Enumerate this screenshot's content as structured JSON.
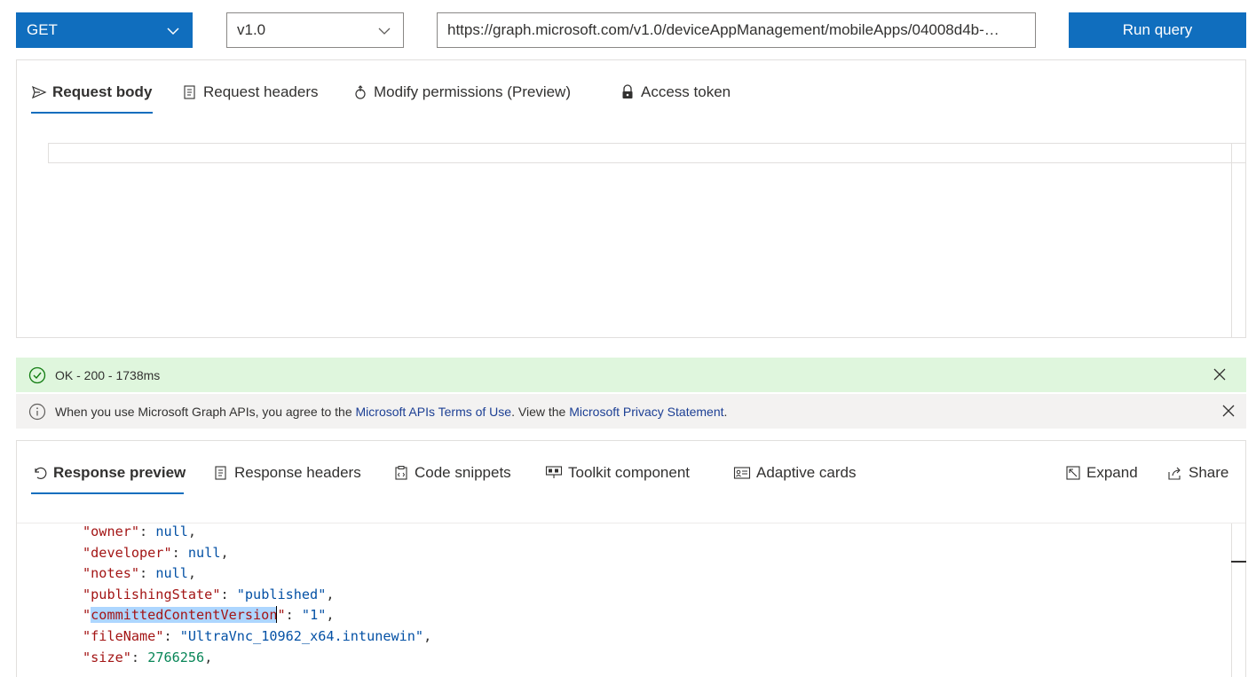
{
  "query": {
    "method": "GET",
    "version": "v1.0",
    "url": "https://graph.microsoft.com/v1.0/deviceAppManagement/mobileApps/04008d4b-…",
    "run_label": "Run query"
  },
  "request_tabs": [
    {
      "label": "Request body",
      "icon": "send-icon",
      "active": true
    },
    {
      "label": "Request headers",
      "icon": "headers-icon",
      "active": false
    },
    {
      "label": "Modify permissions (Preview)",
      "icon": "permissions-icon",
      "active": false
    },
    {
      "label": "Access token",
      "icon": "lock-icon",
      "active": false
    }
  ],
  "status": {
    "text": "OK - 200 - 1738ms",
    "icon": "check-circle-icon"
  },
  "info": {
    "prefix": "When you use Microsoft Graph APIs, you agree to the ",
    "terms_link": "Microsoft APIs Terms of Use",
    "middle": ". View the ",
    "privacy_link": "Microsoft Privacy Statement",
    "suffix": ".",
    "icon": "info-icon"
  },
  "response_tabs": [
    {
      "label": "Response preview",
      "icon": "undo-icon",
      "active": true
    },
    {
      "label": "Response headers",
      "icon": "headers-icon",
      "active": false
    },
    {
      "label": "Code snippets",
      "icon": "code-snippet-icon",
      "active": false
    },
    {
      "label": "Toolkit component",
      "icon": "toolkit-icon",
      "active": false
    },
    {
      "label": "Adaptive cards",
      "icon": "card-icon",
      "active": false
    }
  ],
  "response_actions": [
    {
      "label": "Expand",
      "icon": "expand-icon"
    },
    {
      "label": "Share",
      "icon": "share-icon"
    }
  ],
  "response_lines": [
    {
      "key": "owner",
      "value": "null",
      "type": "kw"
    },
    {
      "key": "developer",
      "value": "null",
      "type": "kw"
    },
    {
      "key": "notes",
      "value": "null",
      "type": "kw"
    },
    {
      "key": "publishingState",
      "value": "\"published\"",
      "type": "s"
    },
    {
      "key": "committedContentVersion",
      "value": "\"1\"",
      "type": "s",
      "selected": true
    },
    {
      "key": "fileName",
      "value": "\"UltraVnc_10962_x64.intunewin\"",
      "type": "s"
    },
    {
      "key": "size",
      "value": "2766256",
      "type": "n"
    }
  ],
  "colors": {
    "accent": "#106ebe",
    "success_bg": "#dff6dd",
    "success_icon": "#107c10",
    "info_bg": "#f3f2f1",
    "json_key": "#a31515",
    "json_string": "#0451a5",
    "json_number": "#098658"
  }
}
